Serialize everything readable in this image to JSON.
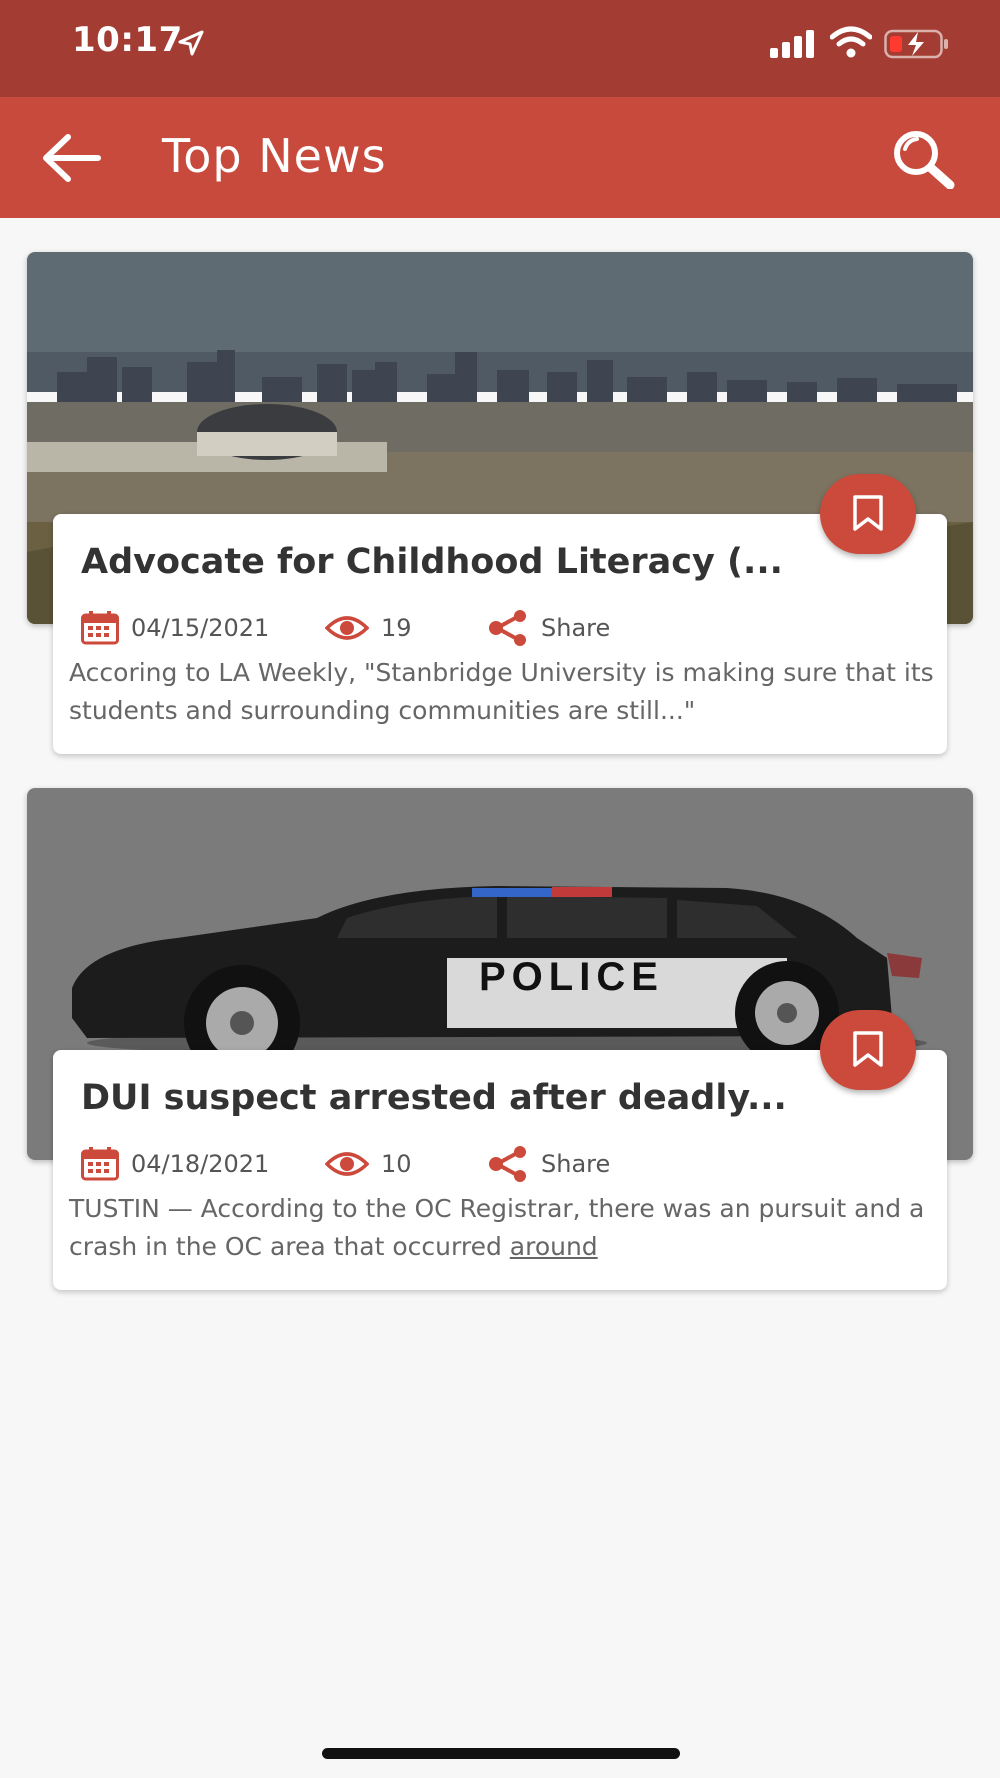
{
  "status_bar": {
    "time": "10:17"
  },
  "app_bar": {
    "title": "Top News",
    "back_icon": "arrow-left-icon",
    "search_icon": "search-icon"
  },
  "colors": {
    "status_bar": "#a33d34",
    "app_bar": "#c84a3c",
    "accent": "#cc4a3b",
    "background": "#f7f7f7"
  },
  "articles": [
    {
      "title": "Advocate for Childhood Literacy (...",
      "date": "04/15/2021",
      "views": "19",
      "share_label": "Share",
      "summary": "Accoring to LA Weekly, \"Stanbridge University is making sure that its students and surrounding communities are still...\"",
      "image": "city-skyline-photo"
    },
    {
      "title": "DUI suspect arrested after deadly...",
      "date": "04/18/2021",
      "views": "10",
      "share_label": "Share",
      "summary_main": "TUSTIN — According to the OC Registrar, there was an pursuit and a crash in the OC area that occurred",
      "summary_link": "around",
      "image": "police-car-photo",
      "car_text": "POLICE"
    }
  ]
}
